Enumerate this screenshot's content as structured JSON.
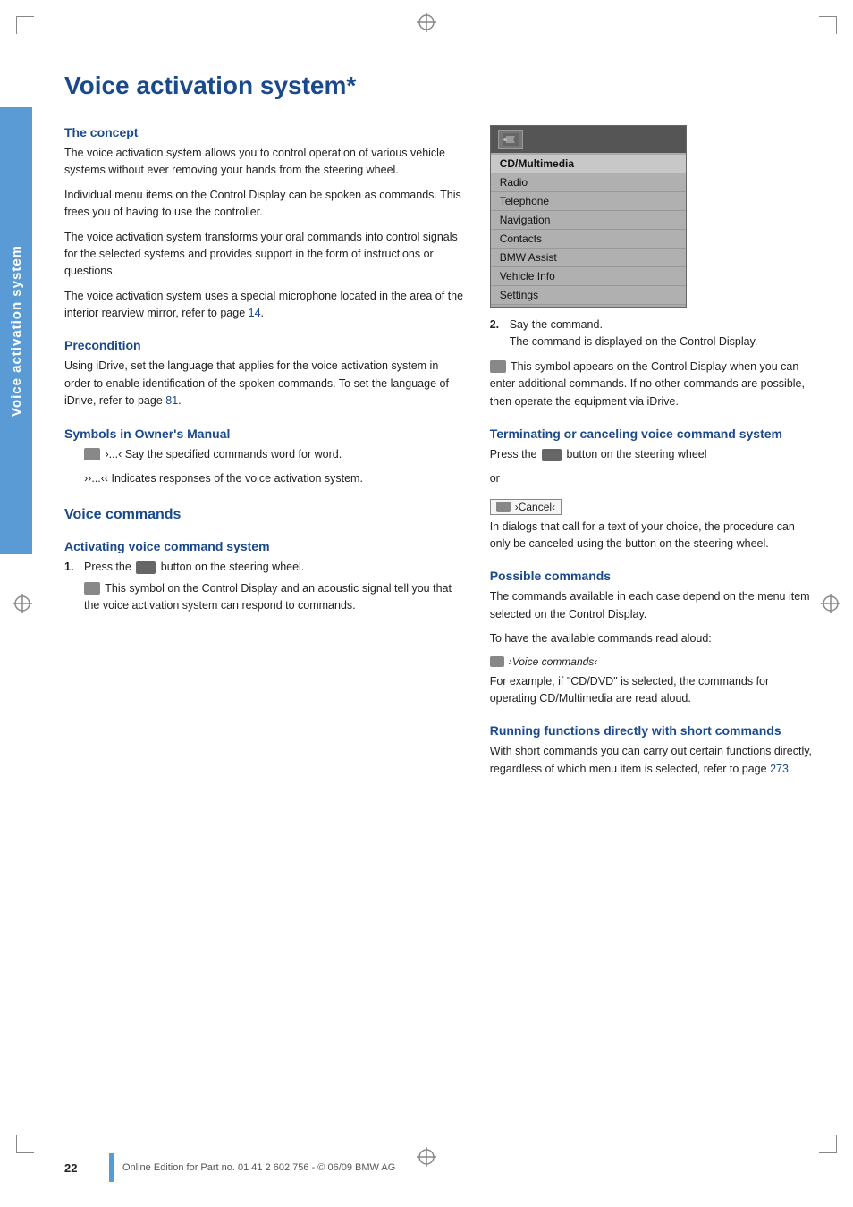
{
  "page": {
    "title": "Voice activation system*",
    "sidebar_label": "Voice activation system",
    "page_number": "22",
    "footer_text": "Online Edition for Part no. 01 41 2 602 756 - © 06/09 BMW AG"
  },
  "left_column": {
    "concept": {
      "heading": "The concept",
      "paragraphs": [
        "The voice activation system allows you to control operation of various vehicle systems without ever removing your hands from the steering wheel.",
        "Individual menu items on the Control Display can be spoken as commands. This frees you of having to use the controller.",
        "The voice activation system transforms your oral commands into control signals for the selected systems and provides support in the form of instructions or questions.",
        "The voice activation system uses a special microphone located in the area of the interior rearview mirror, refer to page 14."
      ]
    },
    "precondition": {
      "heading": "Precondition",
      "text": "Using iDrive, set the language that applies for the voice activation system in order to enable identification of the spoken commands. To set the language of iDrive, refer to page 81."
    },
    "symbols": {
      "heading": "Symbols in Owner's Manual",
      "item1_text": "›...‹ Say the specified commands word for word.",
      "item2_text": "››...‹‹ Indicates responses of the voice activation system."
    },
    "voice_commands": {
      "heading": "Voice commands",
      "activating": {
        "heading": "Activating voice command system",
        "step1": "Press the",
        "step1b": "button on the steering wheel.",
        "step1_sub": "This symbol on the Control Display and an acoustic signal tell you that the voice activation system can respond to commands."
      }
    }
  },
  "right_column": {
    "step2": "Say the command.",
    "step2_sub": "The command is displayed on the Control Display.",
    "symbol_note": "This symbol appears on the Control Display when you can enter additional commands. If no other commands are possible, then operate the equipment via iDrive.",
    "terminating": {
      "heading": "Terminating or canceling voice command system",
      "text1": "Press the",
      "text1b": "button on the steering wheel",
      "text2": "or",
      "cancel_label": "›Cancel‹",
      "text3": "In dialogs that call for a text of your choice, the procedure can only be canceled using the button on the steering wheel."
    },
    "possible_commands": {
      "heading": "Possible commands",
      "text1": "The commands available in each case depend on the menu item selected on the Control Display.",
      "text2": "To have the available commands read aloud:",
      "vc_label": "›Voice commands‹",
      "text3": "For example, if \"CD/DVD\" is selected, the commands for operating CD/Multimedia are read aloud."
    },
    "running": {
      "heading": "Running functions directly with short commands",
      "text": "With short commands you can carry out certain functions directly, regardless of which menu item is selected, refer to page 273."
    }
  },
  "menu": {
    "items": [
      "CD/Multimedia",
      "Radio",
      "Telephone",
      "Navigation",
      "Contacts",
      "BMW Assist",
      "Vehicle Info",
      "Settings"
    ]
  }
}
